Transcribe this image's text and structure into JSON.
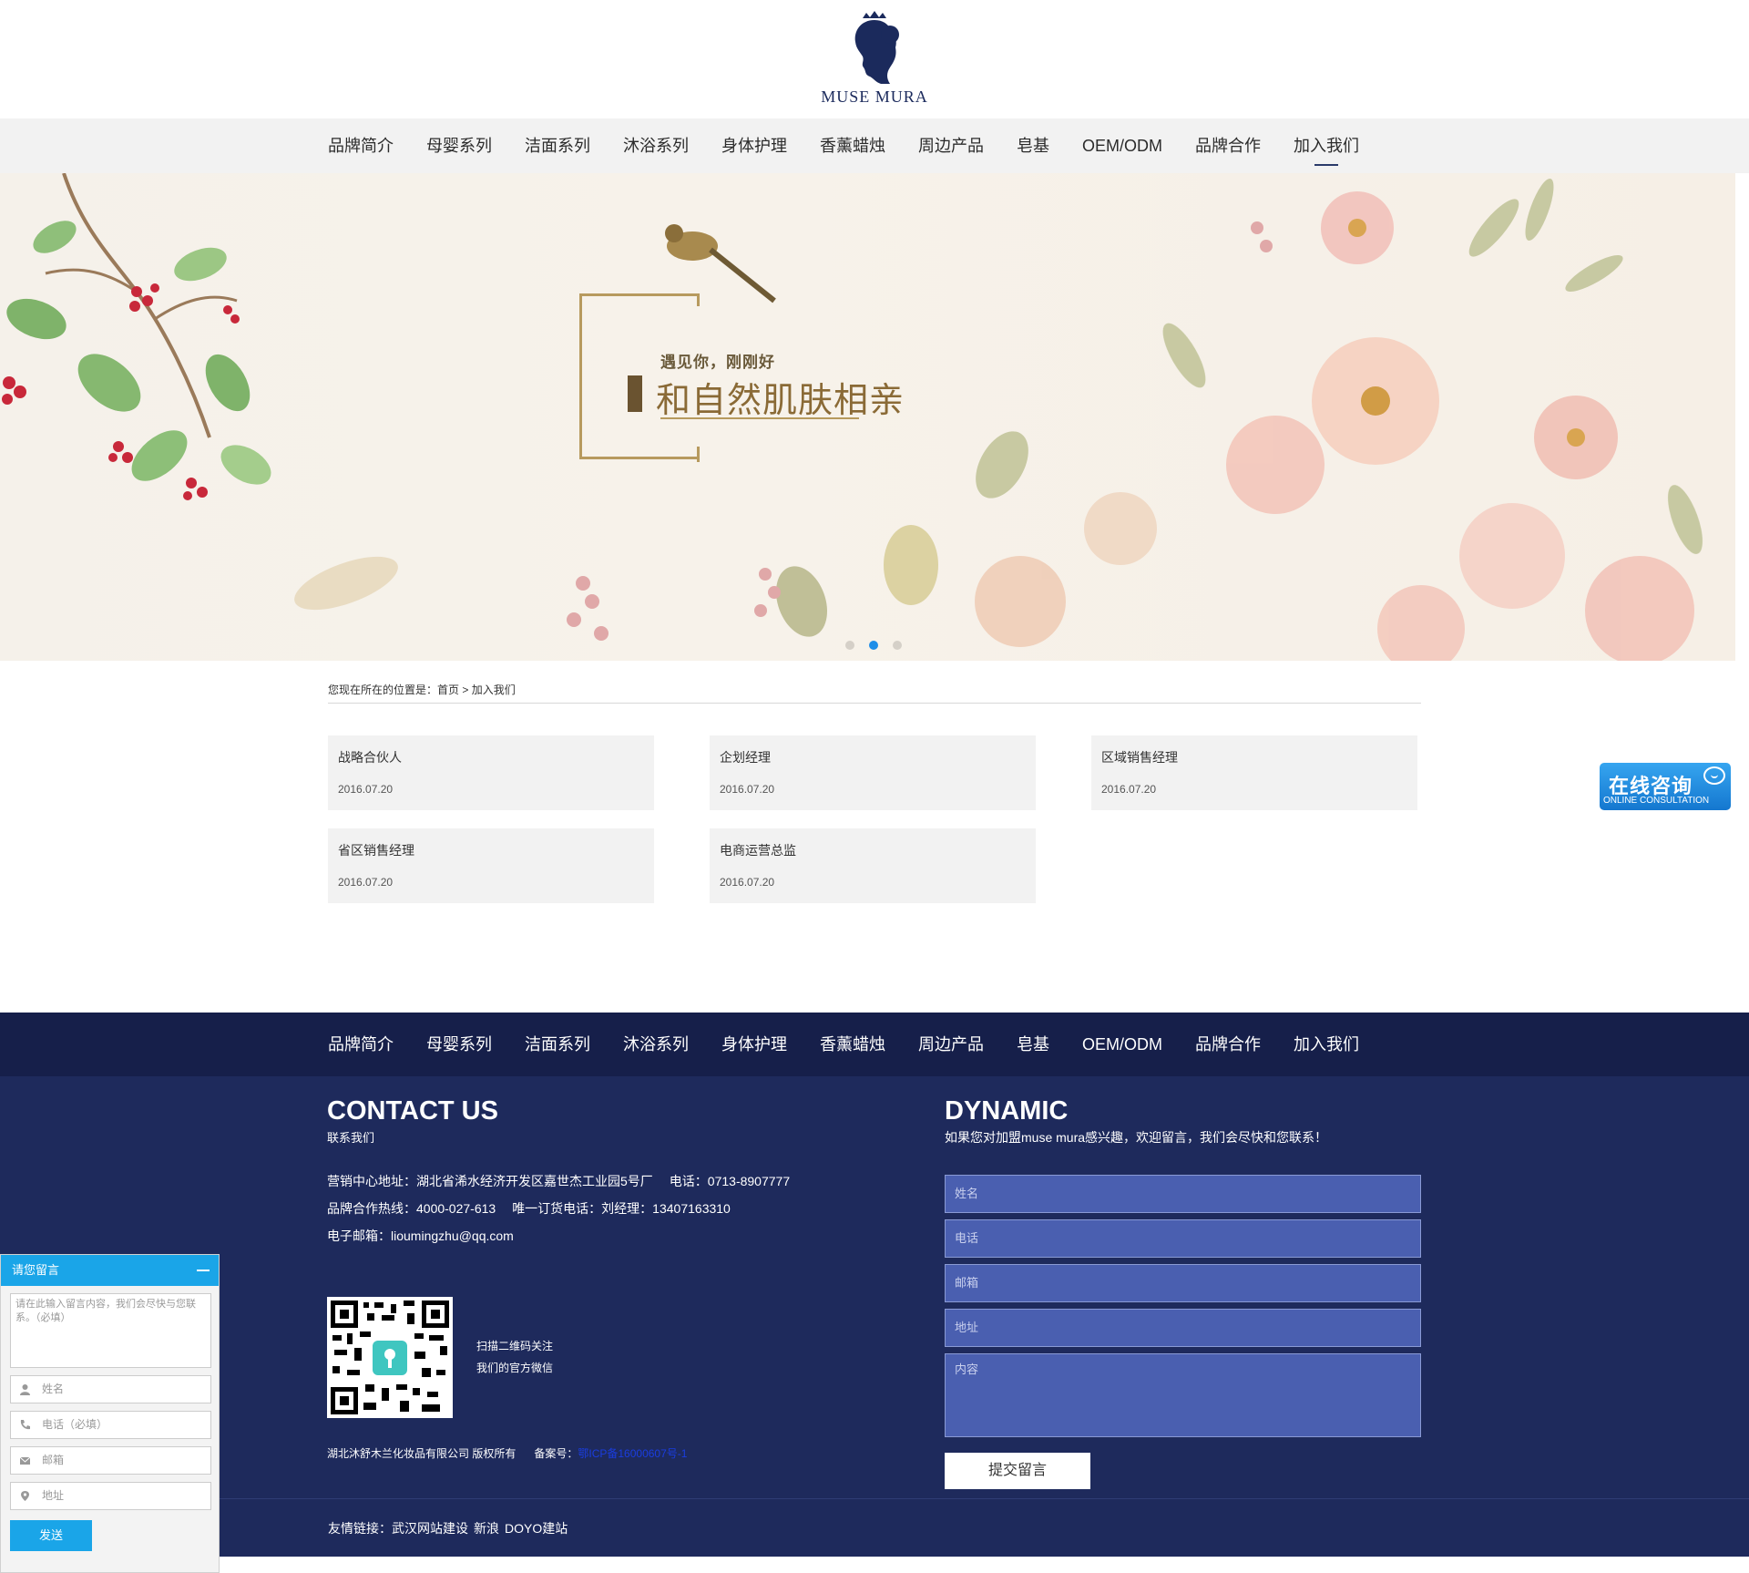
{
  "logo": {
    "text": "MUSE MURA"
  },
  "nav": {
    "items": [
      "品牌简介",
      "母婴系列",
      "洁面系列",
      "沐浴系列",
      "身体护理",
      "香薰蜡烛",
      "周边产品",
      "皂基",
      "OEM/ODM",
      "品牌合作",
      "加入我们"
    ],
    "active_index": 10
  },
  "banner": {
    "subtitle": "遇见你，刚刚好",
    "title": "和自然肌肤相亲",
    "dots": 3,
    "active_dot": 1
  },
  "breadcrumb": {
    "prefix": "您现在所在的位置是：",
    "home": "首页",
    "sep": " > ",
    "current": "加入我们"
  },
  "jobs": [
    {
      "title": "战略合伙人",
      "date": "2016.07.20"
    },
    {
      "title": "企划经理",
      "date": "2016.07.20"
    },
    {
      "title": "区域销售经理",
      "date": "2016.07.20"
    },
    {
      "title": "省区销售经理",
      "date": "2016.07.20"
    },
    {
      "title": "电商运营总监",
      "date": "2016.07.20"
    }
  ],
  "consult": {
    "main": "在线咨询",
    "sub": "ONLINE CONSULTATION"
  },
  "footer": {
    "contact_title": "CONTACT US",
    "contact_subtitle": "联系我们",
    "address": "营销中心地址：湖北省浠水经济开发区嘉世杰工业园5号厂",
    "phone": "电话：0713-8907777",
    "hotline": "品牌合作热线：4000-027-613",
    "order_phone": "唯一订货电话：刘经理：13407163310",
    "email": "电子邮箱：lioumingzhu@qq.com",
    "qr_line1": "扫描二维码关注",
    "qr_line2": "我们的官方微信",
    "copyright": "湖北沐舒木兰化妆品有限公司 版权所有",
    "icp_label": "备案号：",
    "icp_value": "鄂ICP备16000607号-1",
    "dynamic_title": "DYNAMIC",
    "dynamic_intro": "如果您对加盟muse mura感兴趣，欢迎留言，我们会尽快和您联系！",
    "form": {
      "name": "姓名",
      "phone": "电话",
      "email": "邮箱",
      "address": "地址",
      "content": "内容",
      "submit": "提交留言"
    }
  },
  "friends": {
    "label": "友情链接：",
    "links": [
      "武汉网站建设",
      "新浪",
      "DOYO建站"
    ]
  },
  "message_panel": {
    "title": "请您留言",
    "textarea_placeholder": "请在此输入留言内容，我们会尽快与您联系。（必填）",
    "name": "姓名",
    "phone": "电话（必填）",
    "email": "邮箱",
    "address": "地址",
    "send": "发送"
  },
  "colors": {
    "nav_bg": "#f2f2f2",
    "footer_nav_bg": "#161f4a",
    "footer_bg": "#1e2a5c",
    "field_bg": "#4a5fb0",
    "accent_blue": "#1aa5e8",
    "banner_gold": "#b79a5e"
  }
}
